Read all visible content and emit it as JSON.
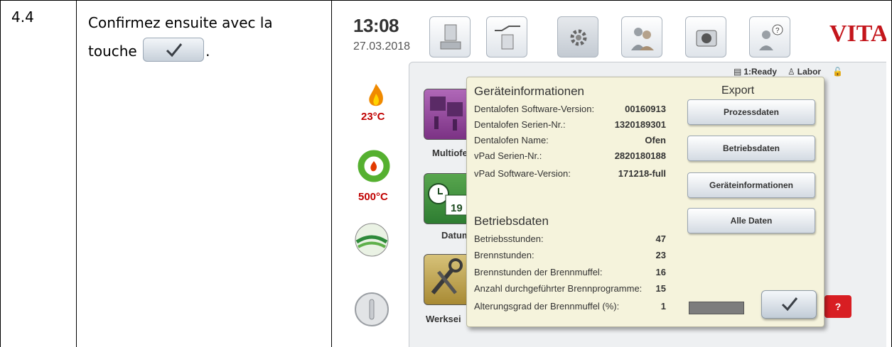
{
  "step": {
    "number": "4.4",
    "text_before": "Confirmez ensuite avec la",
    "text_touche": "touche",
    "text_after": "."
  },
  "header": {
    "time": "13:08",
    "date": "27.03.2018",
    "brand": "VITA"
  },
  "top_icons": [
    "oven-icon",
    "program-icon",
    "settings-icon",
    "users-icon",
    "camera-icon",
    "help-user-icon"
  ],
  "status": {
    "ready": "1:Ready",
    "user": "Labor"
  },
  "left_column": {
    "temp1": "23°C",
    "temp2": "500°C"
  },
  "tiles": {
    "multi_label": "Multiofe",
    "date_label": "Datum",
    "calendar_day": "19",
    "tools_label": "Werksei"
  },
  "dialog": {
    "device_title": "Geräteinformationen",
    "device_rows": [
      {
        "key": "Dentalofen Software-Version:",
        "value": "00160913"
      },
      {
        "key": "Dentalofen Serien-Nr.:",
        "value": "1320189301"
      },
      {
        "key": "Dentalofen Name:",
        "value": "Ofen"
      },
      {
        "key": "vPad Serien-Nr.:",
        "value": "2820180188"
      },
      {
        "key": "vPad Software-Version:",
        "value": "171218-full"
      }
    ],
    "operating_title": "Betriebsdaten",
    "operating_rows": [
      {
        "key": "Betriebsstunden:",
        "value": "47"
      },
      {
        "key": "Brennstunden:",
        "value": "23"
      },
      {
        "key": "Brennstunden der Brennmuffel:",
        "value": "16"
      },
      {
        "key": "Anzahl durchgeführter Brennprogramme:",
        "value": "15"
      },
      {
        "key": "Alterungsgrad der Brennmuffel (%):",
        "value": "1"
      }
    ],
    "export_title": "Export",
    "export_buttons": [
      "Prozessdaten",
      "Betriebsdaten",
      "Geräteinformationen",
      "Alle Daten"
    ]
  },
  "colors": {
    "dialog_bg": "#f5f3dc",
    "temp_red": "#c00000",
    "brand_red": "#c4161c"
  }
}
